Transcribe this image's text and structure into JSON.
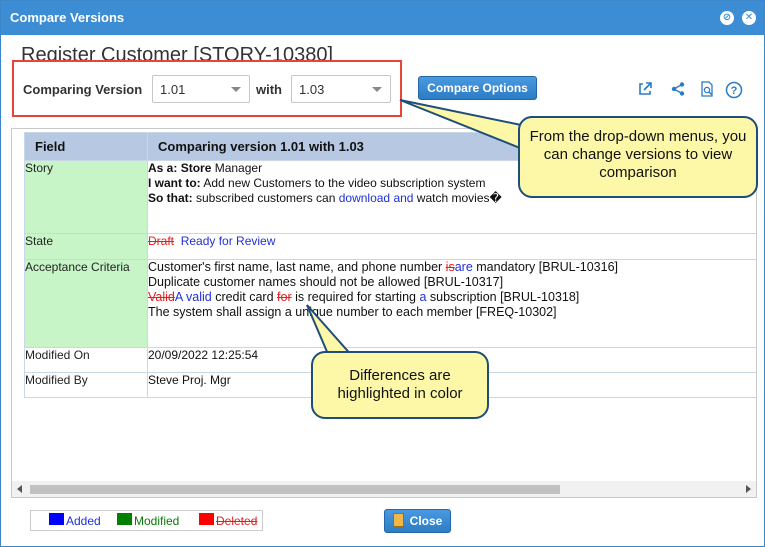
{
  "window": {
    "title": "Compare Versions"
  },
  "story": {
    "title": "Register Customer [STORY-10380]"
  },
  "compare": {
    "label": "Comparing Version",
    "from_version": "1.01",
    "with_label": "with",
    "to_version": "1.03",
    "options_button": "Compare Options"
  },
  "table": {
    "header_field": "Field",
    "header_compare": "Comparing version 1.01 with 1.03",
    "rows": {
      "story": {
        "label": "Story",
        "as_a_label": "As a:",
        "as_a_value_bold": "Store",
        "as_a_value_rest": " Manager",
        "i_want_label": "I want to:",
        "i_want_value": " Add new Customers to the video subscription system",
        "so_that_label": "So that:",
        "so_that_pre": " subscribed customers can ",
        "so_that_added": "download and",
        "so_that_post": " watch movies�"
      },
      "state": {
        "label": "State",
        "deleted": "Draft",
        "added": "Ready for Review"
      },
      "acceptance": {
        "label": "Acceptance Criteria",
        "line1_pre": "Customer's first name, last name, and phone number ",
        "line1_del": "is",
        "line1_add": "are",
        "line1_post": " mandatory [BRUL-10316]",
        "line2": "Duplicate customer names should not be allowed [BRUL-10317]",
        "line3_del1": "Valid",
        "line3_add1": "A valid",
        "line3_mid": " credit card ",
        "line3_del2": "for",
        "line3_mid2": " is required for starting ",
        "line3_add2": "a",
        "line3_post": " subscription [BRUL-10318]",
        "line4": "The system shall assign a unique number to each member [FREQ-10302]"
      },
      "modified_on": {
        "label": "Modified On",
        "value": "20/09/2022 12:25:54"
      },
      "modified_by": {
        "label": "Modified By",
        "value": "Steve Proj. Mgr"
      }
    }
  },
  "legend": {
    "added": "Added",
    "modified": "Modified",
    "deleted": "Deleted"
  },
  "close_button": "Close",
  "callouts": {
    "dropdown": "From the drop-down menus, you can change versions to view comparison",
    "differences": "Differences are highlighted in color"
  },
  "colors": {
    "title_bar": "#3c8dd4",
    "added": "#0000ff",
    "modified": "#008000",
    "deleted": "#ff0000",
    "changed_field": "#c8f5c8",
    "callout_fill": "#fdf7a8"
  },
  "icons": [
    "minimize-icon",
    "close-icon",
    "external-link-icon",
    "share-icon",
    "document-preview-icon",
    "help-icon",
    "close-door-icon"
  ]
}
